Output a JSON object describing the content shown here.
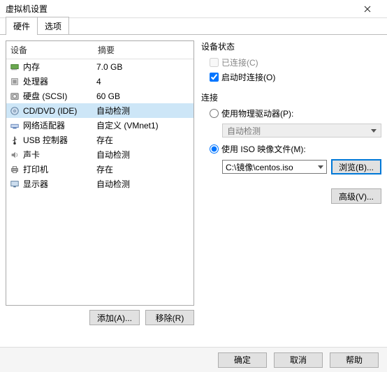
{
  "window": {
    "title": "虚拟机设置"
  },
  "tabs": {
    "hardware": "硬件",
    "options": "选项"
  },
  "list": {
    "header_device": "设备",
    "header_summary": "摘要",
    "rows": [
      {
        "icon": "memory-icon",
        "name": "内存",
        "summary": "7.0 GB"
      },
      {
        "icon": "cpu-icon",
        "name": "处理器",
        "summary": "4"
      },
      {
        "icon": "disk-icon",
        "name": "硬盘 (SCSI)",
        "summary": "60 GB"
      },
      {
        "icon": "cd-icon",
        "name": "CD/DVD (IDE)",
        "summary": "自动检测"
      },
      {
        "icon": "network-icon",
        "name": "网络适配器",
        "summary": "自定义 (VMnet1)"
      },
      {
        "icon": "usb-icon",
        "name": "USB 控制器",
        "summary": "存在"
      },
      {
        "icon": "sound-icon",
        "name": "声卡",
        "summary": "自动检测"
      },
      {
        "icon": "printer-icon",
        "name": "打印机",
        "summary": "存在"
      },
      {
        "icon": "display-icon",
        "name": "显示器",
        "summary": "自动检测"
      }
    ],
    "selected_index": 3
  },
  "left_buttons": {
    "add": "添加(A)...",
    "remove": "移除(R)"
  },
  "status": {
    "title": "设备状态",
    "connected": "已连接(C)",
    "connected_checked": false,
    "connected_enabled": false,
    "connect_at_power_on": "启动时连接(O)",
    "connect_at_power_on_checked": true
  },
  "connection": {
    "title": "连接",
    "use_physical": "使用物理驱动器(P):",
    "physical_value": "自动检测",
    "use_iso": "使用 ISO 映像文件(M):",
    "iso_value": "C:\\镜像\\centos.iso",
    "browse": "浏览(B)...",
    "selected": "iso"
  },
  "advanced": "高级(V)...",
  "footer": {
    "ok": "确定",
    "cancel": "取消",
    "help": "帮助"
  }
}
